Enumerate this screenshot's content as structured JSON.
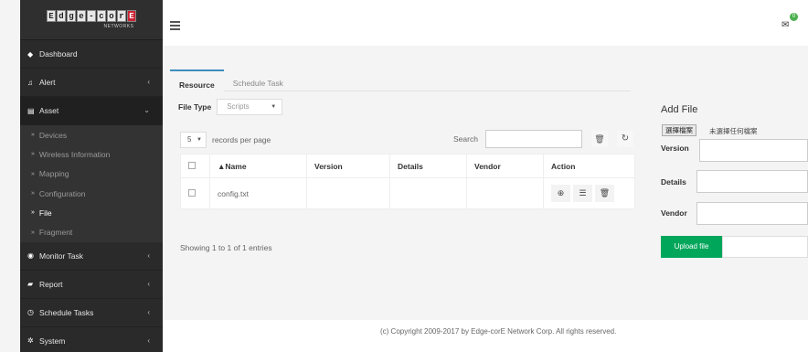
{
  "logo": {
    "letters": [
      "E",
      "d",
      "g",
      "e",
      "-",
      "c",
      "o",
      "r",
      "E"
    ],
    "sub": "NETWORKS"
  },
  "sidebar": {
    "items": [
      {
        "label": "Dashboard",
        "icon": "dashboard-icon",
        "glyph": "◆"
      },
      {
        "label": "Alert",
        "icon": "bell-icon",
        "glyph": "♫",
        "chevron": "‹"
      },
      {
        "label": "Asset",
        "icon": "asset-icon",
        "glyph": "▤",
        "chevron": "⌄"
      }
    ],
    "asset_sub": [
      {
        "label": "Devices"
      },
      {
        "label": "Wireless Information"
      },
      {
        "label": "Mapping"
      },
      {
        "label": "Configuration"
      },
      {
        "label": "File"
      },
      {
        "label": "Fragment"
      }
    ],
    "bottom_items": [
      {
        "label": "Monitor Task",
        "icon": "eye-icon",
        "glyph": "◉",
        "chevron": "‹"
      },
      {
        "label": "Report",
        "icon": "folder-icon",
        "glyph": "▰",
        "chevron": "‹"
      },
      {
        "label": "Schedule Tasks",
        "icon": "clock-icon",
        "glyph": "◷",
        "chevron": "‹"
      },
      {
        "label": "System",
        "icon": "gears-icon",
        "glyph": "✲",
        "chevron": "‹"
      }
    ],
    "active_sub": "File"
  },
  "topbar": {
    "mail_glyph": "✉",
    "notification_count": "0"
  },
  "tabs": [
    {
      "label": "Resource",
      "active": true
    },
    {
      "label": "Schedule Task",
      "active": false
    }
  ],
  "filter": {
    "file_type_label": "File Type",
    "file_type_value": "Scripts"
  },
  "table_controls": {
    "page_size": "5",
    "records_label": "records per page",
    "search_label": "Search"
  },
  "table": {
    "columns": [
      "▲Name",
      "Version",
      "Details",
      "Vendor",
      "Action"
    ],
    "rows": [
      {
        "name": "config.txt",
        "version": "",
        "details": "",
        "vendor": ""
      }
    ]
  },
  "showing": "Showing 1 to 1 of 1 entries",
  "add_file": {
    "title": "Add File",
    "choose_label": "選擇檔案",
    "no_file": "未選擇任何檔案",
    "version_label": "Version",
    "details_label": "Details",
    "vendor_label": "Vendor",
    "upload_label": "Upload file"
  },
  "footer": {
    "copyright": "(c) Copyright 2009-2017 by Edge-corE Network Corp. All rights reserved."
  },
  "colors": {
    "sidebar_bg": "#2a2a2a",
    "accent": "#3c8dbc",
    "upload_green": "#00a65a",
    "notif_green": "#4caf50"
  }
}
